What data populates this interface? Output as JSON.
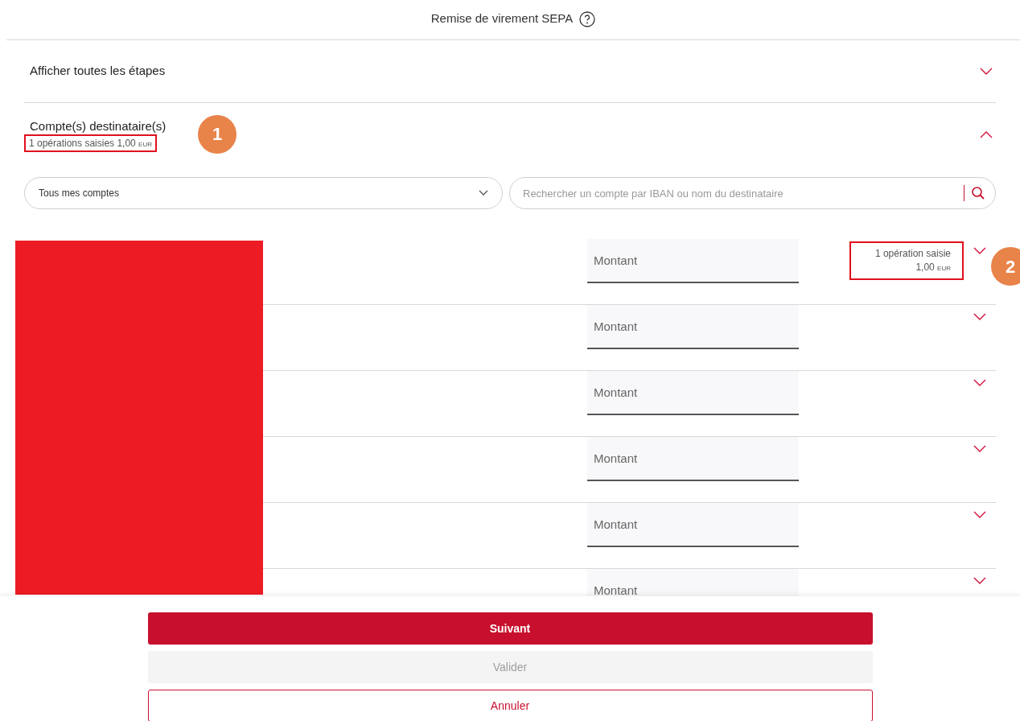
{
  "header": {
    "title": "Remise de virement SEPA"
  },
  "steps": {
    "label": "Afficher toutes les étapes",
    "expanded": false
  },
  "section": {
    "title": "Compte(s) destinataire(s)",
    "summary": "1 opérations saisies 1,00",
    "currency": "EUR",
    "expanded": true,
    "callout": "1"
  },
  "filters": {
    "account_select": "Tous mes comptes",
    "search": {
      "placeholder": "Rechercher un compte par IBAN ou nom du destinataire"
    }
  },
  "rows": [
    {
      "amount_placeholder": "Montant",
      "expanded": false,
      "summary": {
        "operations": "1 opération saisie",
        "amount": "1,00",
        "currency": "EUR"
      },
      "callout": "2"
    },
    {
      "amount_placeholder": "Montant",
      "expanded": false
    },
    {
      "amount_placeholder": "Montant",
      "expanded": false
    },
    {
      "amount_placeholder": "Montant",
      "expanded": false
    },
    {
      "amount_placeholder": "Montant",
      "expanded": false
    },
    {
      "amount_placeholder": "Montant",
      "expanded": false
    }
  ],
  "buttons": [
    {
      "label": "Suivant",
      "kind": "primary",
      "disabled": false
    },
    {
      "label": "Valider",
      "kind": "secondary",
      "disabled": true
    },
    {
      "label": "Annuler",
      "kind": "outline",
      "disabled": false
    }
  ]
}
